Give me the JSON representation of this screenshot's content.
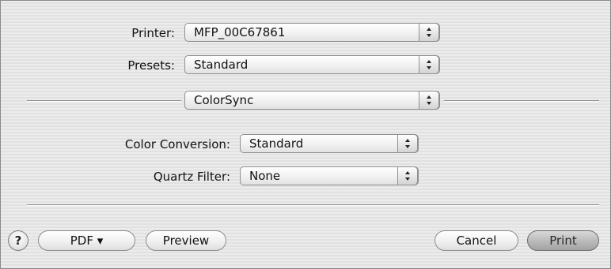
{
  "printer": {
    "label": "Printer:",
    "value": "MFP_00C67861"
  },
  "presets": {
    "label": "Presets:",
    "value": "Standard"
  },
  "pane_selector": {
    "value": "ColorSync"
  },
  "color_conversion": {
    "label": "Color Conversion:",
    "value": "Standard"
  },
  "quartz_filter": {
    "label": "Quartz Filter:",
    "value": "None"
  },
  "footer": {
    "help_label": "?",
    "pdf_label": "PDF ▾",
    "preview_label": "Preview",
    "cancel_label": "Cancel",
    "print_label": "Print"
  },
  "icons": {
    "popup_arrows": "up-down-arrows-icon",
    "help": "question-mark-icon"
  }
}
